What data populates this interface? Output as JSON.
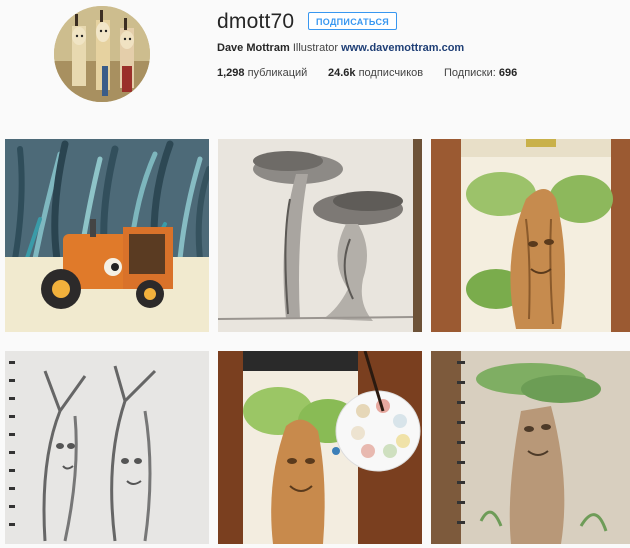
{
  "profile": {
    "username": "dmott70",
    "follow_label": "ПОДПИСАТЬСЯ",
    "full_name": "Dave Mottram",
    "bio_text": "Illustrator",
    "website": "www.davemottram.com"
  },
  "stats": {
    "posts_count": "1,298",
    "posts_label": "публикаций",
    "followers_count": "24.6k",
    "followers_label": "подписчиков",
    "following_label": "Подписки:",
    "following_count": "696"
  },
  "posts": [
    {
      "subject": "orange tractor illustration"
    },
    {
      "subject": "pencil sketch of two trees"
    },
    {
      "subject": "watercolor tree face sketchbook"
    },
    {
      "subject": "pencil tree faces sketchbook"
    },
    {
      "subject": "watercolor tree with paint palette"
    },
    {
      "subject": "tree ent sketch on spiral pad"
    }
  ],
  "colors": {
    "accent": "#3897f0",
    "link": "#1f3f76",
    "background": "#fafafa"
  }
}
